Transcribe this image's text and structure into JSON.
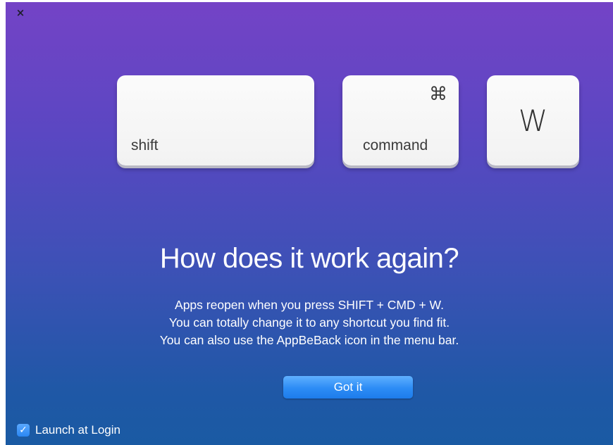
{
  "window": {
    "close_glyph": "×"
  },
  "keys": {
    "shift_label": "shift",
    "command_symbol": "⌘",
    "command_label": "command",
    "w_label": "W"
  },
  "content": {
    "headline": "How does it work again?",
    "lines": [
      "Apps reopen when you press SHIFT + CMD + W.",
      "You can totally change it to any shortcut you find fit.",
      "You can also use the AppBeBack icon in the menu bar."
    ]
  },
  "actions": {
    "got_it_label": "Got it"
  },
  "launch_at_login": {
    "label": "Launch at Login",
    "checked": true,
    "check_glyph": "✓"
  },
  "colors": {
    "gradient_top": "#7443c6",
    "gradient_bottom": "#1a5aa3",
    "accent_blue": "#2c8cf5"
  }
}
